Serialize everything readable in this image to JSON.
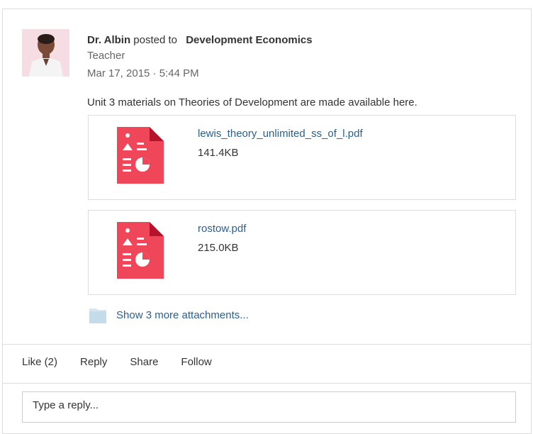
{
  "post": {
    "author": "Dr. Albin",
    "posted_to": "posted to",
    "group": "Development Economics",
    "role": "Teacher",
    "timestamp": "Mar 17, 2015 · 5:44 PM",
    "message": "Unit 3 materials on Theories of Development are made available here."
  },
  "attachments": [
    {
      "name": "lewis_theory_unlimited_ss_of_l.pdf",
      "size": "141.4KB",
      "icon": "pdf-file-icon"
    },
    {
      "name": "rostow.pdf",
      "size": "215.0KB",
      "icon": "pdf-file-icon"
    }
  ],
  "more_attachments": {
    "label": "Show 3 more attachments...",
    "icon": "folder-icon"
  },
  "actions": {
    "like": "Like (2)",
    "reply": "Reply",
    "share": "Share",
    "follow": "Follow"
  },
  "reply_box": {
    "placeholder": "Type a reply..."
  },
  "colors": {
    "link": "#2a5f8f",
    "pdf": "#f0465a",
    "border": "#dddddd"
  }
}
